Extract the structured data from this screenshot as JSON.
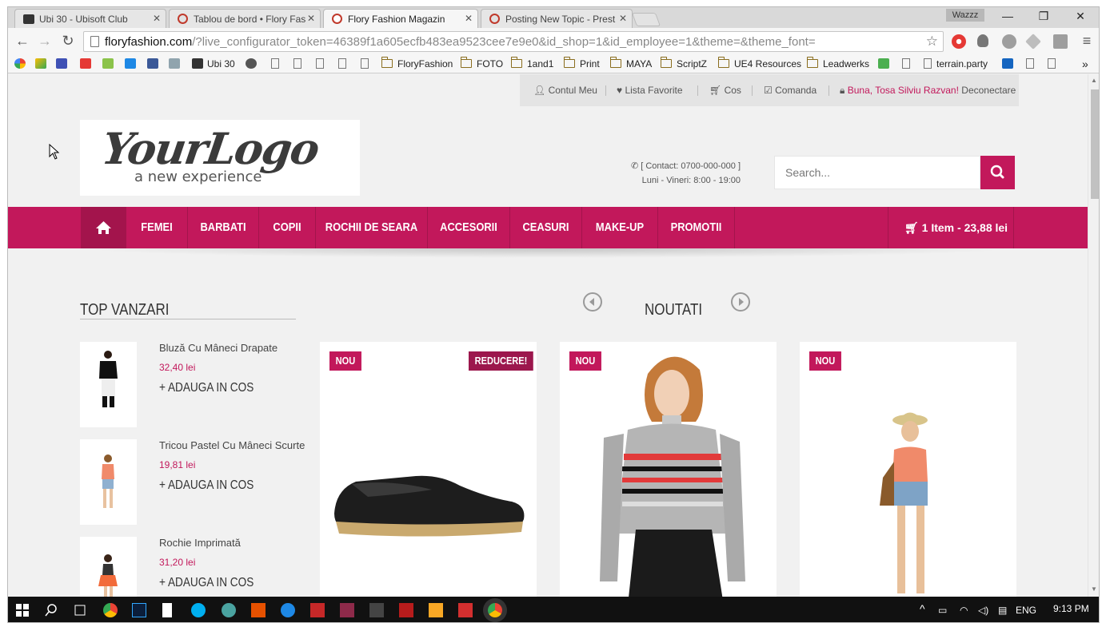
{
  "browser": {
    "tabs": [
      {
        "title": "Ubi 30 - Ubisoft Club",
        "active": false
      },
      {
        "title": "Tablou de bord • Flory Fas",
        "active": false
      },
      {
        "title": "Flory Fashion Magazin",
        "active": true
      },
      {
        "title": "Posting New Topic - Prest",
        "active": false
      }
    ],
    "profile_name": "Wazzz",
    "address_host": "floryfashion.com",
    "address_path": "/?live_configurator_token=46389f1a605ecfb483ea9523cee7e9e0&id_shop=1&id_employee=1&theme=&theme_font=",
    "bookmarks": [
      {
        "label": "Ubi 30",
        "type": "site"
      },
      {
        "label": "FloryFashion",
        "type": "folder"
      },
      {
        "label": "FOTO",
        "type": "folder"
      },
      {
        "label": "1and1",
        "type": "folder"
      },
      {
        "label": "Print",
        "type": "folder"
      },
      {
        "label": "MAYA",
        "type": "folder"
      },
      {
        "label": "ScriptZ",
        "type": "folder"
      },
      {
        "label": "UE4 Resources",
        "type": "folder"
      },
      {
        "label": "Leadwerks",
        "type": "folder"
      },
      {
        "label": "terrain.party",
        "type": "site"
      }
    ],
    "overflow": "»"
  },
  "site": {
    "topnav": {
      "account": "Contul Meu",
      "wishlist": "Lista Favorite",
      "cart": "Cos",
      "checkout": "Comanda",
      "greeting": "Buna, Tosa Silviu Razvan!",
      "logout": "Deconectare"
    },
    "logo": {
      "main": "YourLogo",
      "tagline": "a new experience"
    },
    "contact": {
      "phone": "[ Contact: 0700-000-000 ]",
      "hours": "Luni - Vineri: 8:00 - 19:00"
    },
    "search": {
      "placeholder": "Search..."
    },
    "menu": [
      "FEMEI",
      "BARBATI",
      "COPII",
      "ROCHII DE SEARA",
      "ACCESORII",
      "CEASURI",
      "MAKE-UP",
      "PROMOTII"
    ],
    "cart_summary": "1 Item - 23,88 lei",
    "accent_color": "#c2185b",
    "top_sales": {
      "title": "TOP VANZARI",
      "items": [
        {
          "name": "Bluză Cu Mâneci Drapate",
          "price": "32,40 lei",
          "add": "+ ADAUGA IN COS"
        },
        {
          "name": "Tricou Pastel Cu Mâneci Scurte",
          "price": "19,81 lei",
          "add": "+ ADAUGA IN COS"
        },
        {
          "name": "Rochie Imprimată",
          "price": "31,20 lei",
          "add": "+ ADAUGA IN COS"
        }
      ]
    },
    "new_products": {
      "title": "NOUTATI",
      "products": [
        {
          "badges": [
            "NOU",
            "REDUCERE!"
          ],
          "image": "espadrille-shoe"
        },
        {
          "badges": [
            "NOU"
          ],
          "image": "striped-sweater-model"
        },
        {
          "badges": [
            "NOU"
          ],
          "image": "summer-outfit-model"
        }
      ]
    }
  },
  "taskbar": {
    "language": "ENG",
    "time": "9:13 PM"
  }
}
